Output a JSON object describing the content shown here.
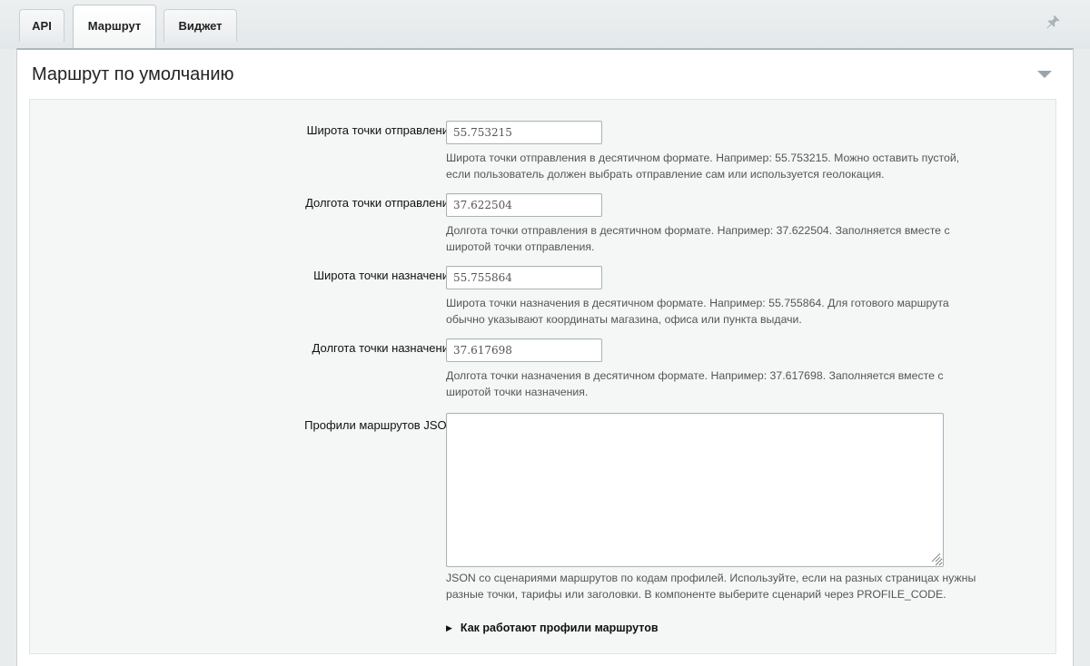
{
  "tabs": [
    {
      "label": "API"
    },
    {
      "label": "Маршрут"
    },
    {
      "label": "Виджет"
    }
  ],
  "section": {
    "title": "Маршрут по умолчанию"
  },
  "fields": {
    "from_lat": {
      "label": "Широта точки отправления",
      "value": "55.753215",
      "hint_line1": "Широта точки отправления в десятичном формате. Например: 55.753215. Можно оставить пустой,",
      "hint_line2": "если пользователь должен выбрать отправление сам или используется геолокация."
    },
    "from_lng": {
      "label": "Долгота точки отправления",
      "value": "37.622504",
      "hint_line1": "Долгота точки отправления в десятичном формате. Например: 37.622504. Заполняется вместе с",
      "hint_line2": "широтой точки отправления."
    },
    "to_lat": {
      "label": "Широта точки назначения",
      "value": "55.755864",
      "hint_line1": "Широта точки назначения в десятичном формате. Например: 55.755864. Для готового маршрута",
      "hint_line2": "обычно указывают координаты магазина, офиса или пункта выдачи."
    },
    "to_lng": {
      "label": "Долгота точки назначения",
      "value": "37.617698",
      "hint_line1": "Долгота точки назначения в десятичном формате. Например: 37.617698. Заполняется вместе с",
      "hint_line2": "широтой точки назначения."
    },
    "profiles_json": {
      "label": "Профили маршрутов JSON",
      "value": "",
      "hint_line1": "JSON со сценариями маршрутов по кодам профилей. Используйте, если на разных страницах нужны",
      "hint_line2": "разные точки, тарифы или заголовки. В компоненте выберите сценарий через PROFILE_CODE."
    }
  },
  "details": {
    "label": "Как работают профили маршрутов"
  },
  "icons": {
    "pin": "pin-icon",
    "collapse": "triangle-down-icon",
    "details": "triangle-right-icon"
  }
}
